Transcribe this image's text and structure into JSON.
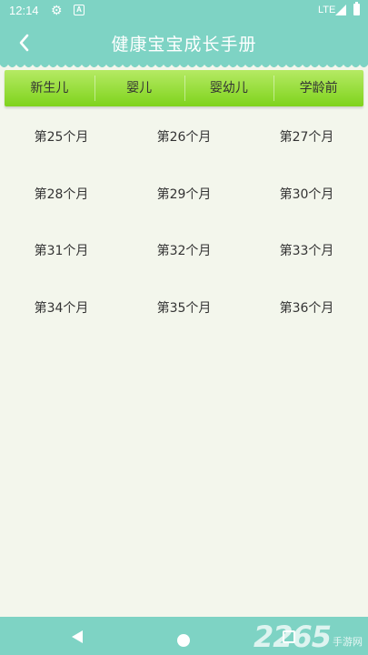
{
  "status_bar": {
    "time": "12:14",
    "network": "LTE",
    "icons": [
      "gear-icon",
      "a-icon",
      "signal-icon",
      "battery-icon"
    ]
  },
  "header": {
    "title": "健康宝宝成长手册",
    "back_icon": "chevron-left-icon"
  },
  "tabs": [
    {
      "label": "新生儿"
    },
    {
      "label": "婴儿"
    },
    {
      "label": "婴幼儿"
    },
    {
      "label": "学龄前"
    }
  ],
  "months": [
    [
      "第25个月",
      "第26个月",
      "第27个月"
    ],
    [
      "第28个月",
      "第29个月",
      "第30个月"
    ],
    [
      "第31个月",
      "第32个月",
      "第33个月"
    ],
    [
      "第34个月",
      "第35个月",
      "第36个月"
    ]
  ],
  "nav_bar": {
    "icons": [
      "back-triangle-icon",
      "home-circle-icon",
      "recent-square-icon"
    ]
  },
  "watermark": {
    "number": "2265",
    "text": "手游网"
  },
  "colors": {
    "teal": "#7ed3c4",
    "tab_green": "#8bd92a",
    "background": "#f3f6ec"
  }
}
